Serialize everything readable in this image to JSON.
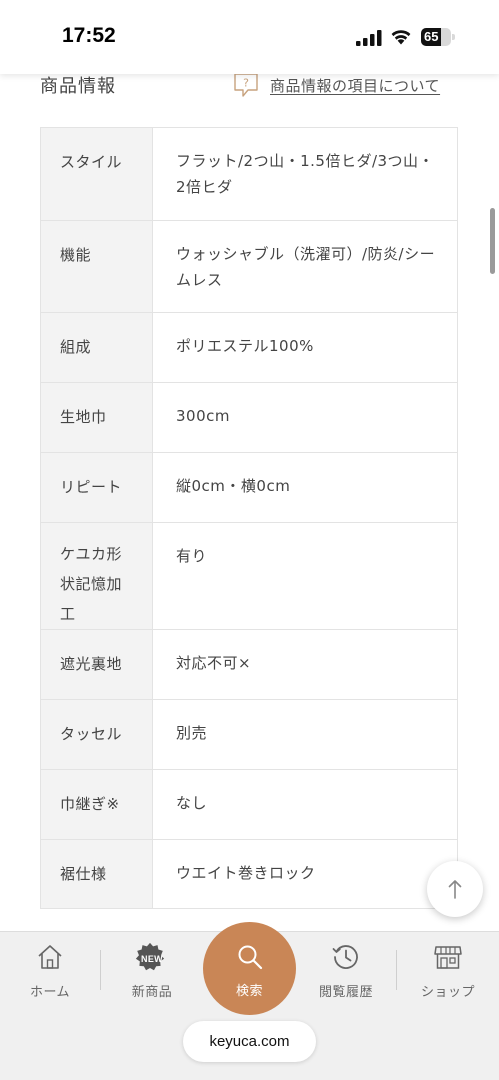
{
  "status_bar": {
    "time": "17:52",
    "battery_level": "65",
    "battery_fraction": 0.65,
    "icons": [
      "signal-icon",
      "wifi-icon",
      "battery-icon"
    ]
  },
  "section": {
    "title": "商品情報",
    "info_link": "商品情報の項目について",
    "info_icon": "question-bubble-icon"
  },
  "specs": [
    {
      "label": "スタイル",
      "value": "フラット/2つ山・1.5倍ヒダ/3つ山・2倍ヒダ"
    },
    {
      "label": "機能",
      "value": "ウォッシャブル（洗濯可）/防炎/シームレス"
    },
    {
      "label": "組成",
      "value": "ポリエステル100%"
    },
    {
      "label": "生地巾",
      "value": "300cm"
    },
    {
      "label": "リピート",
      "value": "縦0cm・横0cm"
    },
    {
      "label": "ケユカ形状記憶加工",
      "value": "有り"
    },
    {
      "label": "遮光裏地",
      "value": "対応不可×"
    },
    {
      "label": "タッセル",
      "value": "別売"
    },
    {
      "label": "巾継ぎ※",
      "value": "なし"
    },
    {
      "label": "裾仕様",
      "value": "ウエイト巻きロック"
    }
  ],
  "back_to_top_icon": "arrow-up-icon",
  "bottom_nav": {
    "home": "ホーム",
    "new_items": "新商品",
    "new_badge": "NEW",
    "search": "検索",
    "history": "閲覧履歴",
    "shop": "ショップ",
    "accent_color": "#c98656"
  },
  "url": "keyuca.com"
}
